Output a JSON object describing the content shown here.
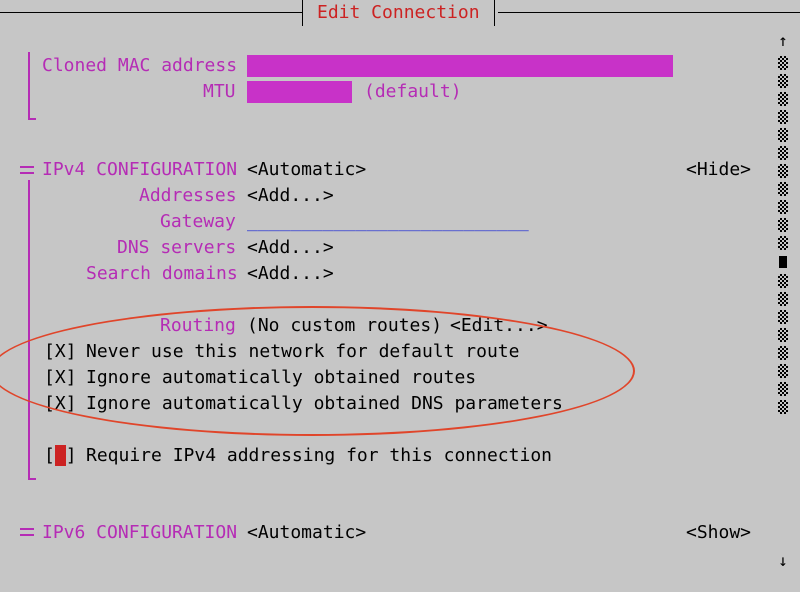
{
  "window": {
    "title": "Edit Connection"
  },
  "cloned_mac": {
    "label": "Cloned MAC address",
    "value": "__________________________________________"
  },
  "mtu": {
    "label": "MTU",
    "value": "__________",
    "suffix": "(default)"
  },
  "ipv4": {
    "label": "IPv4 CONFIGURATION",
    "mode": "<Automatic>",
    "toggle": "<Hide>",
    "addresses_label": "Addresses",
    "addresses_button": "<Add...>",
    "gateway_label": "Gateway",
    "gateway_value": "__________________________",
    "dns_label": "DNS servers",
    "dns_button": "<Add...>",
    "search_label": "Search domains",
    "search_button": "<Add...>",
    "routing_label": "Routing",
    "routing_value": "(No custom routes)",
    "routing_button": "<Edit...>",
    "checkboxes": [
      {
        "mark": "[X]",
        "label": "Never use this network for default route"
      },
      {
        "mark": "[X]",
        "label": "Ignore automatically obtained routes"
      },
      {
        "mark": "[X]",
        "label": "Ignore automatically obtained DNS parameters"
      }
    ],
    "require": {
      "open": "[",
      "close": "]",
      "label": "Require IPv4 addressing for this connection"
    }
  },
  "ipv6": {
    "label": "IPv6 CONFIGURATION",
    "mode": "<Automatic>",
    "toggle": "<Show>"
  },
  "scrollbar": {
    "up_arrow": "↑",
    "down_arrow": "↓"
  },
  "colors": {
    "accent": "#b52cb5",
    "title": "#cc2222",
    "annotation": "#e0452a",
    "link": "#1f2bd6"
  }
}
